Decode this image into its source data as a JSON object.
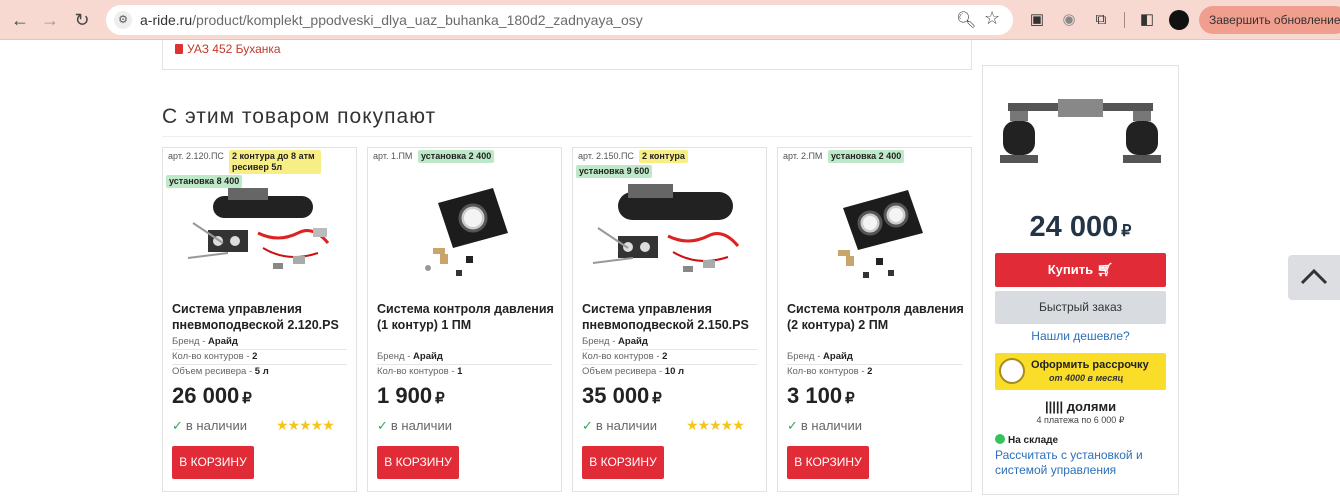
{
  "browser": {
    "url_domain": "a-ride.ru",
    "url_path": "/product/komplekt_ppodveski_dlya_uaz_buhanka_180d2_zadnyaya_osy",
    "update_button": "Завершить обновление"
  },
  "top": {
    "car_link": "УАЗ 452 Буханка"
  },
  "section_title": "С этим товаром покупают",
  "products": [
    {
      "art": "арт. 2.120.ПС",
      "badges": [
        {
          "text": "2 контура до 8 атм ресивер 5л",
          "color": "yellow"
        },
        {
          "text": "установка 8 400",
          "color": "green"
        }
      ],
      "name": "Система управления пневмоподвеской 2.120.PS",
      "specs": [
        {
          "label": "Бренд",
          "value": "Арайд"
        },
        {
          "label": "Кол-во контуров",
          "value": "2"
        },
        {
          "label": "Объем ресивера",
          "value": "5 л"
        }
      ],
      "price": "26 000",
      "currency": "₽",
      "stock": "в наличии",
      "rating": 5,
      "cart": "В КОРЗИНУ"
    },
    {
      "art": "арт. 1.ПМ",
      "badges": [
        {
          "text": "установка 2 400",
          "color": "green"
        }
      ],
      "name": "Система контроля давления (1 контур) 1 ПМ",
      "specs": [
        {
          "label": "Бренд",
          "value": "Арайд"
        },
        {
          "label": "Кол-во контуров",
          "value": "1"
        }
      ],
      "price": "1 900",
      "currency": "₽",
      "stock": "в наличии",
      "rating": 0,
      "cart": "В КОРЗИНУ"
    },
    {
      "art": "арт. 2.150.ПС",
      "badges": [
        {
          "text": "2 контура",
          "color": "yellow"
        },
        {
          "text": "установка 9 600",
          "color": "green"
        }
      ],
      "name": "Система управления пневмоподвеской 2.150.PS",
      "specs": [
        {
          "label": "Бренд",
          "value": "Арайд"
        },
        {
          "label": "Кол-во контуров",
          "value": "2"
        },
        {
          "label": "Объем ресивера",
          "value": "10 л"
        }
      ],
      "price": "35 000",
      "currency": "₽",
      "stock": "в наличии",
      "rating": 5,
      "cart": "В КОРЗИНУ"
    },
    {
      "art": "арт. 2.ПМ",
      "badges": [
        {
          "text": "установка 2 400",
          "color": "green"
        }
      ],
      "name": "Система контроля давления (2 контура) 2 ПМ",
      "specs": [
        {
          "label": "Бренд",
          "value": "Арайд"
        },
        {
          "label": "Кол-во контуров",
          "value": "2"
        }
      ],
      "price": "3 100",
      "currency": "₽",
      "stock": "в наличии",
      "rating": 0,
      "cart": "В КОРЗИНУ"
    }
  ],
  "sidebar": {
    "price": "24 000",
    "currency": "₽",
    "buy": "Купить",
    "quick_order": "Быстрый заказ",
    "cheaper": "Нашли дешевле?",
    "installment_title": "Оформить рассрочку",
    "installment_sub": "от 4000 в месяц",
    "dolyami": "||||| долями",
    "dolyami_sub": "4 платежа по 6 000 ₽",
    "in_stock": "На складе",
    "calc_link": "Рассчитать с установкой и системой управления"
  }
}
